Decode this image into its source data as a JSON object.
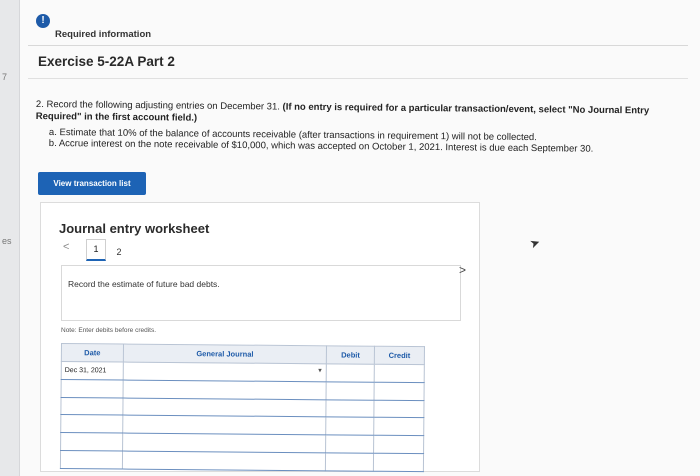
{
  "gutter": {
    "mark_top": "7",
    "mark_mid": "es"
  },
  "header": {
    "info_icon": "!",
    "required_label": "Required information",
    "exercise_title": "Exercise 5-22A Part 2"
  },
  "question": {
    "intro": "2. Record the following adjusting entries on December 31.",
    "emphasis": " (If no entry is required for a particular transaction/event, select \"No Journal Entry Required\" in the first account field.)",
    "task_a": "a. Estimate that 10% of the balance of accounts receivable (after transactions in requirement 1) will not be collected.",
    "task_b": "b. Accrue interest on the note receivable of $10,000, which was accepted on October 1, 2021. Interest is due each September 30."
  },
  "buttons": {
    "view_transaction_list": "View transaction list"
  },
  "worksheet": {
    "title": "Journal entry worksheet",
    "prev_icon": "<",
    "next_icon": ">",
    "tabs": [
      "1",
      "2"
    ],
    "prompt": "Record the estimate of future bad debts.",
    "note": "Note: Enter debits before credits.",
    "columns": {
      "date": "Date",
      "account": "General Journal",
      "debit": "Debit",
      "credit": "Credit"
    },
    "rows": [
      {
        "date": "Dec 31, 2021",
        "account": "",
        "debit": "",
        "credit": ""
      },
      {
        "date": "",
        "account": "",
        "debit": "",
        "credit": ""
      },
      {
        "date": "",
        "account": "",
        "debit": "",
        "credit": ""
      },
      {
        "date": "",
        "account": "",
        "debit": "",
        "credit": ""
      },
      {
        "date": "",
        "account": "",
        "debit": "",
        "credit": ""
      },
      {
        "date": "",
        "account": "",
        "debit": "",
        "credit": ""
      }
    ]
  },
  "colors": {
    "accent": "#1d63b5",
    "header_bg": "#eaeef4"
  }
}
